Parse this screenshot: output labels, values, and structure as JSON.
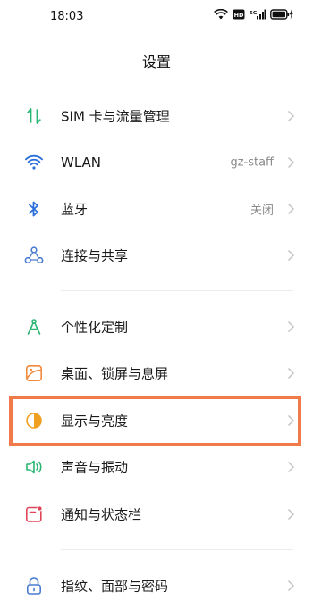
{
  "status_bar": {
    "time": "18:03",
    "hd_badge": "HD",
    "network": "5G"
  },
  "header": {
    "title": "设置"
  },
  "items": [
    {
      "label": "SIM 卡与流量管理",
      "value": "",
      "icon": "sim-data-icon"
    },
    {
      "label": "WLAN",
      "value": "gz-staff",
      "icon": "wifi-icon"
    },
    {
      "label": "蓝牙",
      "value": "关闭",
      "icon": "bluetooth-icon"
    },
    {
      "label": "连接与共享",
      "value": "",
      "icon": "share-connection-icon"
    },
    {
      "label": "个性化定制",
      "value": "",
      "icon": "personalize-icon"
    },
    {
      "label": "桌面、锁屏与息屏",
      "value": "",
      "icon": "wallpaper-icon"
    },
    {
      "label": "显示与亮度",
      "value": "",
      "icon": "display-brightness-icon"
    },
    {
      "label": "声音与振动",
      "value": "",
      "icon": "sound-icon"
    },
    {
      "label": "通知与状态栏",
      "value": "",
      "icon": "notification-icon"
    },
    {
      "label": "指纹、面部与密码",
      "value": "",
      "icon": "lock-icon"
    }
  ],
  "highlighted_item": "显示与亮度",
  "colors": {
    "highlight_border": "#f07a4a",
    "sim": "#2bb673",
    "wifi": "#2a6fdb",
    "bluetooth": "#2a6fdb",
    "connect": "#4a7bd0",
    "personalize": "#2bb673",
    "wallpaper": "#f08a3c",
    "display": "#f0a020",
    "sound": "#2bb673",
    "notification": "#e0455a",
    "lock": "#4a7bd0"
  }
}
